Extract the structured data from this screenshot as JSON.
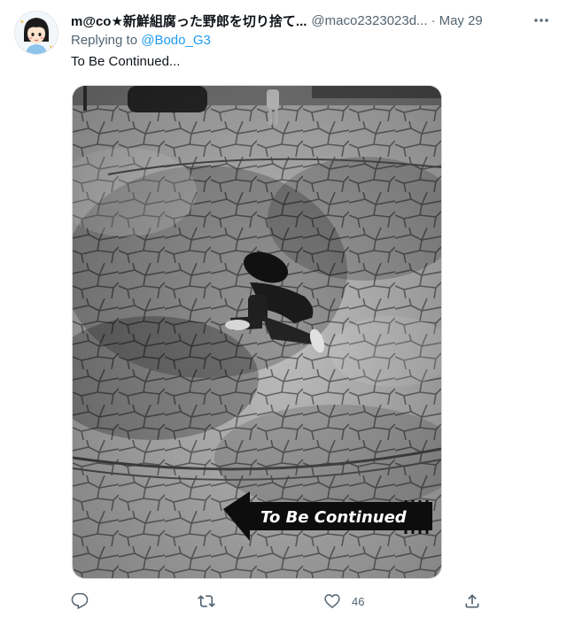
{
  "tweet": {
    "display_name": "m@co★新鮮組腐った野郎を切り捨て...",
    "handle": "@maco2323023d...",
    "separator": "·",
    "date": "May 29",
    "reply_prefix": "Replying to",
    "reply_to": "@Bodo_G3",
    "text": "To Be Continued...",
    "media": {
      "overlay_text": "To Be Continued",
      "description": "black-and-white photo"
    },
    "actions": {
      "reply_count": "",
      "retweet_count": "",
      "like_count": "46"
    }
  },
  "icons": {
    "avatar": "avatar-icon",
    "more": "more-icon",
    "reply": "reply-icon",
    "retweet": "retweet-icon",
    "like": "heart-icon",
    "share": "share-icon"
  },
  "colors": {
    "text_primary": "#0f1419",
    "text_secondary": "#536471",
    "link": "#1d9bf0",
    "border": "#cfd9de"
  }
}
